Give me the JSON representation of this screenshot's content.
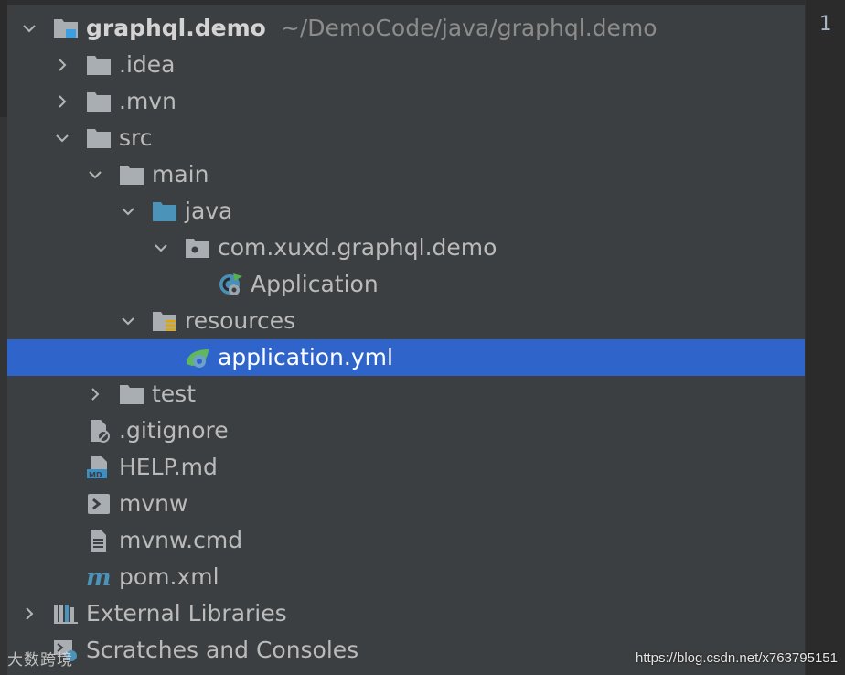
{
  "tree": {
    "project": {
      "name": "graphql.demo",
      "path": "~/DemoCode/java/graphql.demo"
    },
    "items": [
      {
        "label": ".idea"
      },
      {
        "label": ".mvn"
      },
      {
        "label": "src"
      },
      {
        "label": "main"
      },
      {
        "label": "java"
      },
      {
        "label": "com.xuxd.graphql.demo"
      },
      {
        "label": "Application"
      },
      {
        "label": "resources"
      },
      {
        "label": "application.yml"
      },
      {
        "label": "test"
      },
      {
        "label": ".gitignore"
      },
      {
        "label": "HELP.md"
      },
      {
        "label": "mvnw"
      },
      {
        "label": "mvnw.cmd"
      },
      {
        "label": "pom.xml"
      },
      {
        "label": "External Libraries"
      },
      {
        "label": "Scratches and Consoles"
      }
    ]
  },
  "editor": {
    "line_number": "1"
  },
  "watermark": {
    "url": "https://blog.csdn.net/x763795151",
    "brand": "大数跨境"
  },
  "colors": {
    "background": "#3c3f41",
    "selection": "#2f65ca",
    "folder": "#a9aeb2",
    "source_folder": "#4b93b8"
  }
}
